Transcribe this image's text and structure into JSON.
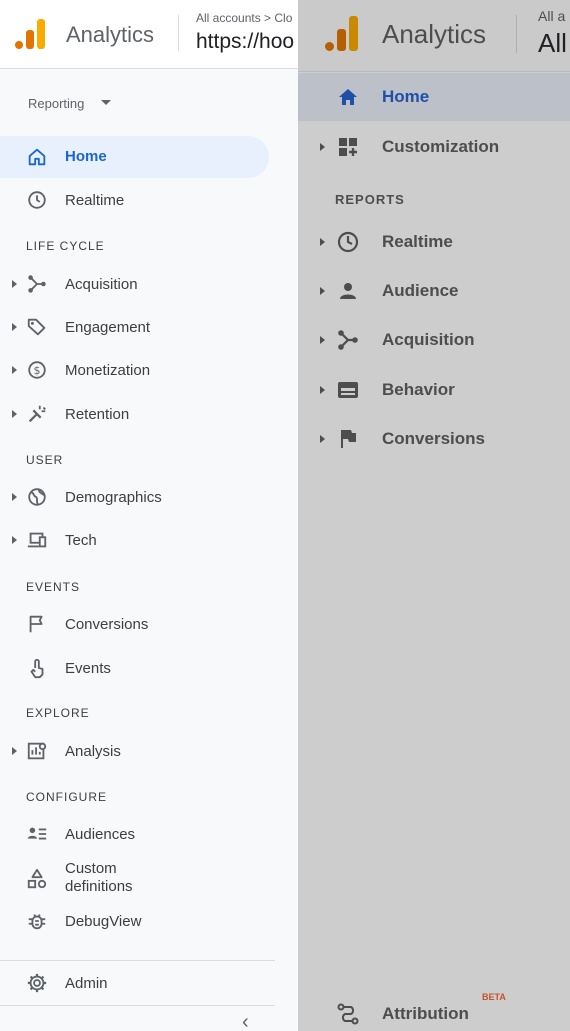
{
  "left": {
    "header": {
      "app_name": "Analytics",
      "breadcrumb": "All accounts > Clo",
      "property": "https://hoo"
    },
    "reporting_label": "Reporting",
    "nav": {
      "home": "Home",
      "realtime": "Realtime",
      "sec_lifecycle": "LIFE CYCLE",
      "acquisition": "Acquisition",
      "engagement": "Engagement",
      "monetization": "Monetization",
      "retention": "Retention",
      "sec_user": "USER",
      "demographics": "Demographics",
      "tech": "Tech",
      "sec_events": "EVENTS",
      "conversions": "Conversions",
      "events": "Events",
      "sec_explore": "EXPLORE",
      "analysis": "Analysis",
      "sec_configure": "CONFIGURE",
      "audiences": "Audiences",
      "custom_def_1": "Custom",
      "custom_def_2": "definitions",
      "debugview": "DebugView",
      "admin": "Admin",
      "collapse": "‹"
    }
  },
  "right": {
    "header": {
      "app_name": "Analytics",
      "breadcrumb": "All a",
      "property": "All"
    },
    "nav": {
      "home": "Home",
      "customization": "Customization",
      "sec_reports": "REPORTS",
      "realtime": "Realtime",
      "audience": "Audience",
      "acquisition": "Acquisition",
      "behavior": "Behavior",
      "conversions": "Conversions",
      "attribution": "Attribution",
      "beta": "BETA"
    }
  },
  "colors": {
    "accent_blue": "#1967d2",
    "active_bg": "#e8f0fe",
    "logo_orange": "#e37400",
    "logo_yellow": "#f9ab00",
    "dim_overlay": "#cdcdcd"
  },
  "icons": {
    "home": "home-icon",
    "realtime": "clock-icon",
    "acquisition": "acquisition-icon",
    "engagement": "tag-icon",
    "monetization": "dollar-icon",
    "retention": "magnet-icon",
    "demographics": "globe-icon",
    "tech": "devices-icon",
    "conversions": "flag-icon",
    "events": "touch-icon",
    "analysis": "analysis-icon",
    "audiences": "audiences-icon",
    "custom_definitions": "shapes-icon",
    "debugview": "bug-icon",
    "admin": "gear-icon",
    "customization": "dashboard-icon",
    "audience": "person-icon",
    "behavior": "behavior-icon",
    "attribution": "attribution-icon"
  }
}
